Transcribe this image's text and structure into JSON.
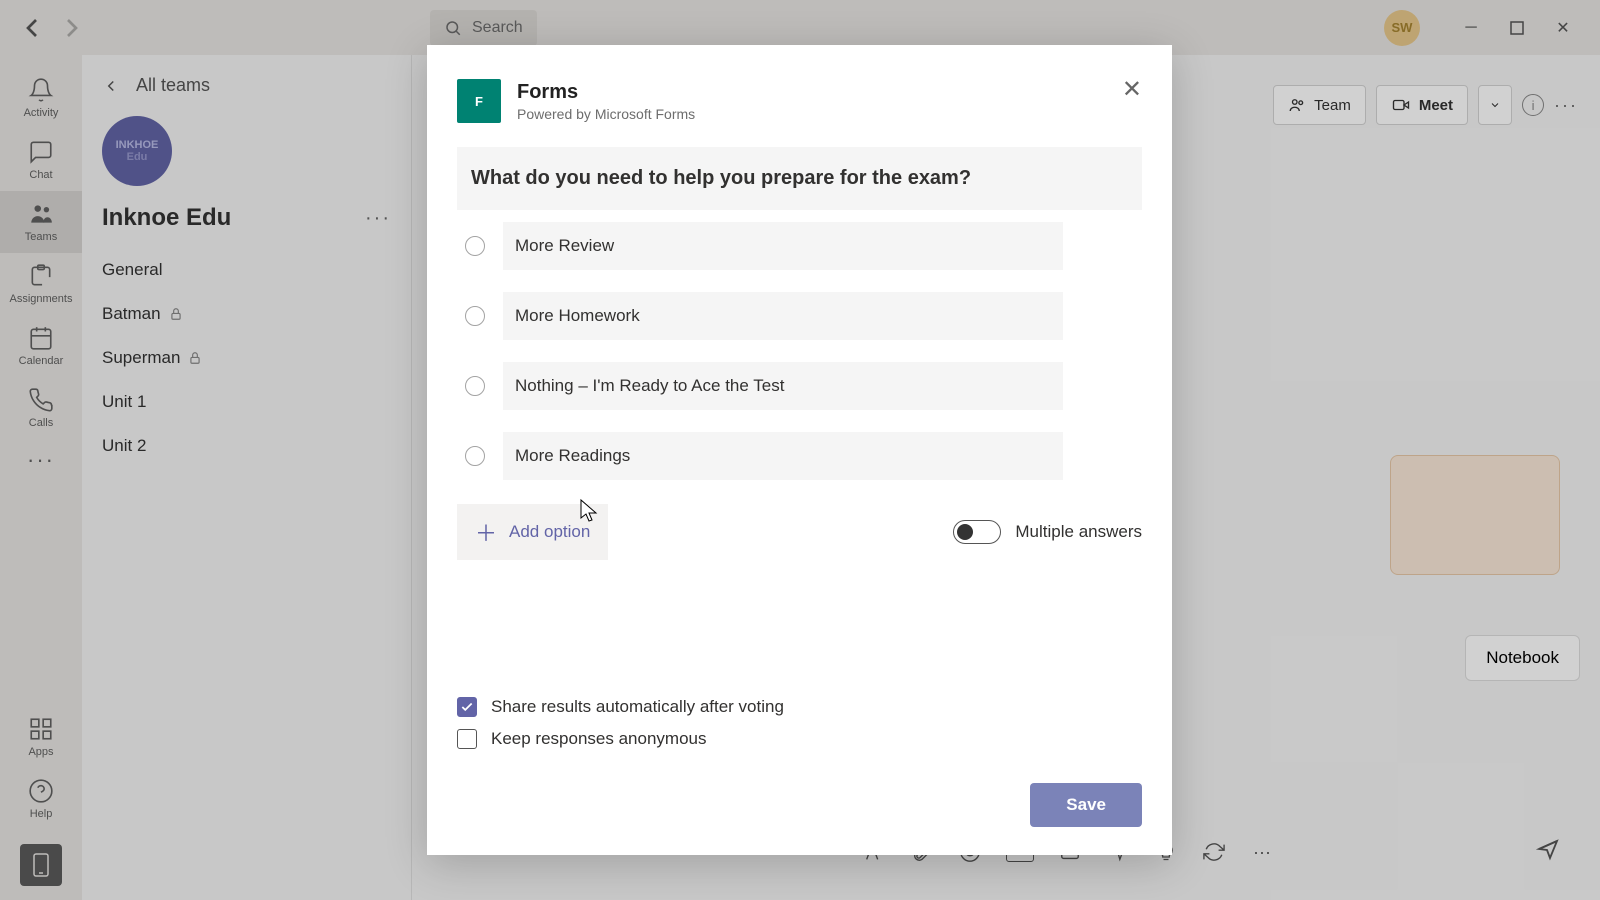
{
  "titlebar": {
    "search_placeholder": "Search",
    "avatar_initials": "SW"
  },
  "rail": {
    "activity": "Activity",
    "chat": "Chat",
    "teams": "Teams",
    "assignments": "Assignments",
    "calendar": "Calendar",
    "calls": "Calls",
    "apps": "Apps",
    "help": "Help"
  },
  "sidebar": {
    "all_teams": "All teams",
    "team_logo_text1": "INKHOE",
    "team_logo_text2": "Edu",
    "team_name": "Inknoe Edu",
    "channels": [
      {
        "label": "General",
        "locked": false
      },
      {
        "label": "Batman",
        "locked": true
      },
      {
        "label": "Superman",
        "locked": true
      },
      {
        "label": "Unit 1",
        "locked": false
      },
      {
        "label": "Unit 2",
        "locked": false
      }
    ]
  },
  "topbar": {
    "team": "Team",
    "meet": "Meet",
    "notebook": "Notebook"
  },
  "modal": {
    "title": "Forms",
    "subtitle": "Powered by Microsoft Forms",
    "question": "What do you need to help you prepare for the exam?",
    "options": [
      "More Review",
      "More Homework",
      "Nothing – I'm Ready to Ace the Test",
      "More Readings"
    ],
    "add_option": "Add option",
    "multiple_answers": "Multiple answers",
    "share_results": "Share results automatically after voting",
    "anonymous": "Keep responses anonymous",
    "save": "Save"
  }
}
